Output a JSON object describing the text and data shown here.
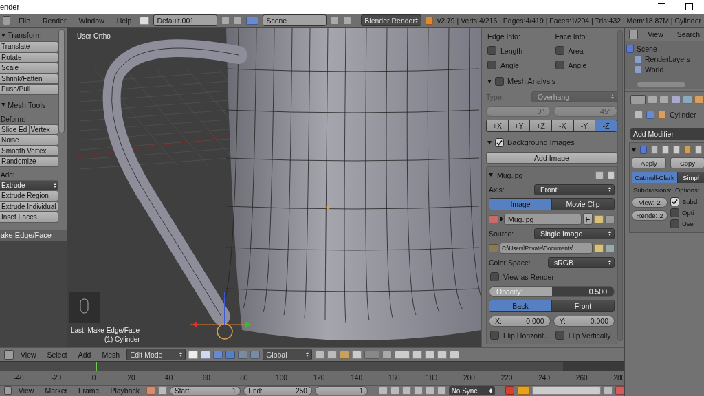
{
  "window": {
    "title": "ender"
  },
  "menu": [
    "File",
    "Render",
    "Window",
    "Help"
  ],
  "layout": {
    "name": "Default.001"
  },
  "scene": {
    "name": "Scene"
  },
  "engine": "Blender Render",
  "stats": "v2.79 | Verts:4/216 | Edges:4/419 | Faces:1/204 | Tris:432 | Mem:18.87M | Cylinder",
  "toolshelf": {
    "sections": [
      {
        "title": "Transform",
        "items": [
          {
            "kind": "button",
            "labels": [
              "Translate"
            ]
          },
          {
            "kind": "button",
            "labels": [
              "Rotate"
            ]
          },
          {
            "kind": "button",
            "labels": [
              "Scale"
            ]
          },
          {
            "kind": "button",
            "labels": [
              "Shrink/Fatten"
            ]
          },
          {
            "kind": "button",
            "labels": [
              "Push/Pull"
            ]
          }
        ]
      },
      {
        "title": "Mesh Tools",
        "items": [
          {
            "kind": "label",
            "text": "Deform:"
          },
          {
            "kind": "button",
            "labels": [
              "Slide Ed",
              "Vertex"
            ]
          },
          {
            "kind": "button",
            "labels": [
              "Noise"
            ]
          },
          {
            "kind": "button",
            "labels": [
              "Smooth Vertex"
            ]
          },
          {
            "kind": "button",
            "labels": [
              "Randomize"
            ]
          },
          {
            "kind": "label",
            "text": "Add:"
          },
          {
            "kind": "dropdown",
            "text": "Extrude"
          },
          {
            "kind": "button",
            "labels": [
              "Extrude Region"
            ]
          },
          {
            "kind": "button",
            "labels": [
              "Extrude Individual"
            ]
          },
          {
            "kind": "button",
            "labels": [
              "Inset Faces"
            ]
          }
        ]
      }
    ],
    "operator_panel": "ake Edge/Face"
  },
  "viewport": {
    "view_name": "User Ortho",
    "last_operator": "Last: Make Edge/Face",
    "object": "(1) Cylinder"
  },
  "npanel": {
    "rows": [
      {
        "kind": "labels",
        "items": [
          "Edge Info:",
          "Face Info:"
        ]
      },
      {
        "kind": "checks",
        "items": [
          {
            "label": "Length",
            "checked": false
          },
          {
            "label": "Area",
            "checked": false
          }
        ]
      },
      {
        "kind": "checks",
        "items": [
          {
            "label": "Angle",
            "checked": false
          },
          {
            "label": "Angle",
            "checked": false
          }
        ]
      },
      {
        "kind": "header",
        "title": "Mesh Analysis",
        "checked": false
      },
      {
        "kind": "select",
        "label": "Type:",
        "value": "Overhang",
        "disabled": true
      },
      {
        "kind": "numbers",
        "disabled": true,
        "items": [
          {
            "value": "0°"
          },
          {
            "value": "45°"
          }
        ]
      },
      {
        "kind": "toggles",
        "items": [
          {
            "label": "+X",
            "selected": false
          },
          {
            "label": "+Y",
            "selected": false
          },
          {
            "label": "+Z",
            "selected": false
          },
          {
            "label": "-X",
            "selected": false
          },
          {
            "label": "-Y",
            "selected": false
          },
          {
            "label": "-Z",
            "selected": true
          }
        ]
      },
      {
        "kind": "header",
        "title": "Background Images",
        "checked": true
      },
      {
        "kind": "button",
        "text": "Add Image"
      },
      {
        "kind": "box",
        "title": "Mug.jpg",
        "rows": [
          {
            "kind": "select",
            "label": "Axis:",
            "value": "Front",
            "disabled": false
          },
          {
            "kind": "toggles",
            "items": [
              {
                "label": "Image",
                "selected": true
              },
              {
                "label": "Movie Clip",
                "selected": false
              }
            ]
          },
          {
            "kind": "file",
            "value": "Mug.jpg",
            "flag": "F"
          },
          {
            "kind": "select",
            "label": "Source:",
            "value": "Single Image",
            "disabled": false
          },
          {
            "kind": "path",
            "value": "C:\\Users\\Private\\Documents\\..."
          },
          {
            "kind": "select",
            "label": "Color Space:",
            "value": "sRGB",
            "disabled": false
          },
          {
            "kind": "checks",
            "items": [
              {
                "label": "View as Render",
                "checked": false
              }
            ]
          },
          {
            "kind": "slider",
            "label": "Opacity:",
            "value": "0.500",
            "level": 0.5
          },
          {
            "kind": "toggles",
            "items": [
              {
                "label": "Back",
                "selected": true
              },
              {
                "label": "Front",
                "selected": false
              }
            ]
          },
          {
            "kind": "numbers",
            "disabled": false,
            "items": [
              {
                "label": "X:",
                "value": "0.000"
              },
              {
                "label": "Y:",
                "value": "0.000"
              }
            ]
          },
          {
            "kind": "checks",
            "items": [
              {
                "label": "Flip Horizont...",
                "checked": false
              },
              {
                "label": "Flip Vertically",
                "checked": false
              }
            ]
          }
        ]
      }
    ]
  },
  "outliner": {
    "menus": [
      "View",
      "Search"
    ],
    "tree": [
      {
        "label": "Scene",
        "children": [
          {
            "label": "RenderLayers"
          },
          {
            "label": "World"
          }
        ]
      }
    ]
  },
  "properties": {
    "breadcrumb": "Cylinder",
    "add_modifier": "Add Modifier",
    "buttons": [
      "Apply",
      "Copy"
    ],
    "subdivision_types": [
      {
        "label": "Catmull-Clark",
        "selected": true
      },
      {
        "label": "Simpl",
        "selected": false
      }
    ],
    "labels": [
      "Subdivisions:",
      "Options:"
    ],
    "levels": [
      {
        "label": "View:",
        "value": "2"
      },
      {
        "label": "Rende:",
        "value": "2"
      }
    ],
    "options": [
      {
        "label": "Subd",
        "checked": true
      },
      {
        "label": "Opti",
        "checked": false
      },
      {
        "label": "Use",
        "checked": false
      }
    ]
  },
  "view3d_header": {
    "menus": [
      "View",
      "Select",
      "Add",
      "Mesh"
    ],
    "mode": "Edit Mode",
    "orientation": "Global"
  },
  "timeline": {
    "ticks": [
      "-40",
      "-20",
      "0",
      "20",
      "40",
      "60",
      "80",
      "100",
      "120",
      "140",
      "160",
      "180",
      "200",
      "220",
      "240",
      "260",
      "280"
    ],
    "menus": [
      "View",
      "Marker",
      "Frame",
      "Playback"
    ],
    "start": {
      "label": "Start:",
      "value": "1"
    },
    "end": {
      "label": "End:",
      "value": "250"
    },
    "current": "1",
    "sync": "No Sync"
  }
}
